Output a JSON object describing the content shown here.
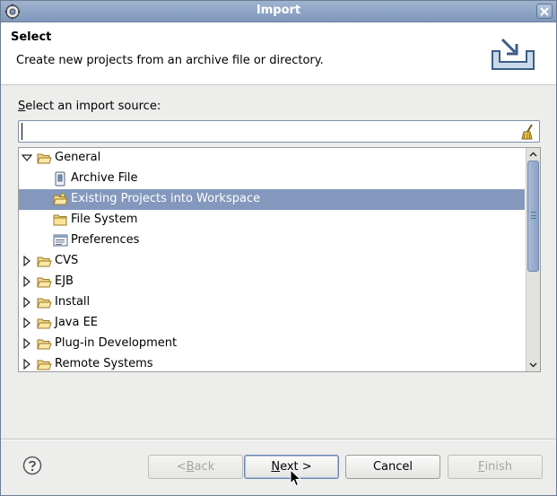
{
  "window": {
    "title": "Import",
    "icon": "eclipse-gear-icon",
    "close_icon": "close-x-icon"
  },
  "banner": {
    "heading": "Select",
    "description": "Create new projects from an archive file or directory.",
    "icon": "import-tray-icon"
  },
  "source": {
    "label_mnemonic": "S",
    "label_rest": "elect an import source:",
    "filter_value": "",
    "filter_placeholder": "",
    "clear_icon": "broom-clear-icon"
  },
  "tree": {
    "items": [
      {
        "label": "General",
        "level": 0,
        "expanded": true,
        "icon": "folder-open-icon",
        "selected": false
      },
      {
        "label": "Archive File",
        "level": 1,
        "icon": "archive-file-icon",
        "selected": false
      },
      {
        "label": "Existing Projects into Workspace",
        "level": 1,
        "icon": "existing-projects-icon",
        "selected": true
      },
      {
        "label": "File System",
        "level": 1,
        "icon": "folder-icon",
        "selected": false
      },
      {
        "label": "Preferences",
        "level": 1,
        "icon": "preferences-icon",
        "selected": false
      },
      {
        "label": "CVS",
        "level": 0,
        "expanded": false,
        "icon": "folder-open-icon",
        "selected": false
      },
      {
        "label": "EJB",
        "level": 0,
        "expanded": false,
        "icon": "folder-open-icon",
        "selected": false
      },
      {
        "label": "Install",
        "level": 0,
        "expanded": false,
        "icon": "folder-open-icon",
        "selected": false
      },
      {
        "label": "Java EE",
        "level": 0,
        "expanded": false,
        "icon": "folder-open-icon",
        "selected": false
      },
      {
        "label": "Plug-in Development",
        "level": 0,
        "expanded": false,
        "icon": "folder-open-icon",
        "selected": false
      },
      {
        "label": "Remote Systems",
        "level": 0,
        "expanded": false,
        "icon": "folder-open-icon",
        "selected": false
      }
    ],
    "scroll_position": 0.0
  },
  "buttons": {
    "help_icon": "help-question-icon",
    "back": {
      "mnemonic": "",
      "pre": "< ",
      "mn": "B",
      "post": "ack",
      "enabled": false
    },
    "next": {
      "pre": "",
      "mn": "N",
      "post": "ext >",
      "enabled": true
    },
    "cancel": {
      "label": "Cancel",
      "enabled": true
    },
    "finish": {
      "pre": "",
      "mn": "F",
      "post": "inish",
      "enabled": false
    }
  },
  "colors": {
    "selection": "#8398bc",
    "titlebar": "#8fa6c6"
  }
}
